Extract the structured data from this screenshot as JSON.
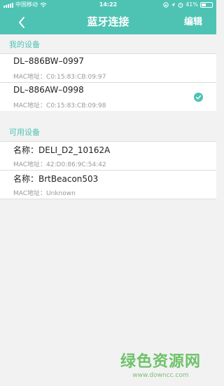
{
  "status_bar": {
    "carrier": "中国移动",
    "time": "14:22",
    "battery": "41%",
    "battery_level": 0.41
  },
  "nav": {
    "title": "蓝牙连接",
    "edit_label": "编辑"
  },
  "my_devices": {
    "title": "我的设备",
    "items": [
      {
        "name": "DL–886BW–0997",
        "mac": "MAC地址：C0:15:83:CB:09:97",
        "selected": false
      },
      {
        "name": "DL–886AW–0998",
        "mac": "MAC地址：C0:15:83:CB:09:98",
        "selected": true
      }
    ]
  },
  "available_devices": {
    "title": "可用设备",
    "items": [
      {
        "name": "名称：DELI_D2_10162A",
        "mac": "MAC地址：42:D0:86:9C:54:42"
      },
      {
        "name": "名称：BrtBeacon503",
        "mac": "MAC地址：Unknown"
      }
    ]
  },
  "watermark": {
    "text": "绿色资源网",
    "url": "www.downcc.com"
  },
  "colors": {
    "accent": "#4ec3b4",
    "background": "#f2f2f2"
  }
}
